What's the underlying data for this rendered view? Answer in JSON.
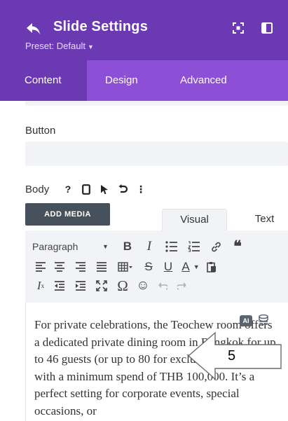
{
  "header": {
    "title": "Slide Settings",
    "preset": "Preset: Default",
    "icons": [
      "back-arrow-icon",
      "expand-icon",
      "sidebar-toggle-icon"
    ]
  },
  "tabs": [
    {
      "label": "Content",
      "active": true
    },
    {
      "label": "Design",
      "active": false
    },
    {
      "label": "Advanced",
      "active": false
    }
  ],
  "fields": {
    "button_label": "Button",
    "button_value": "",
    "body_label": "Body"
  },
  "body_icons": [
    "help-icon",
    "mobile-icon",
    "cursor-icon",
    "undo-icon",
    "more-vertical-icon"
  ],
  "editor": {
    "add_media": "ADD MEDIA",
    "tab_visual": "Visual",
    "tab_text": "Text",
    "paragraph": "Paragraph",
    "ai_badge": "AI",
    "content": "For private celebrations, the Teochew room offers a dedicated private dining room in Bangkok for up to 46 guests (or up to 80 for exclusive buyouts), with a minimum spend of THB 100,000. It’s a perfect setting for corporate events, special occasions, or"
  },
  "callout": {
    "number": "5"
  },
  "colors": {
    "header": "#6b3ab3",
    "tabs": "#8c4fd6",
    "panel": "#f1f3f6"
  }
}
